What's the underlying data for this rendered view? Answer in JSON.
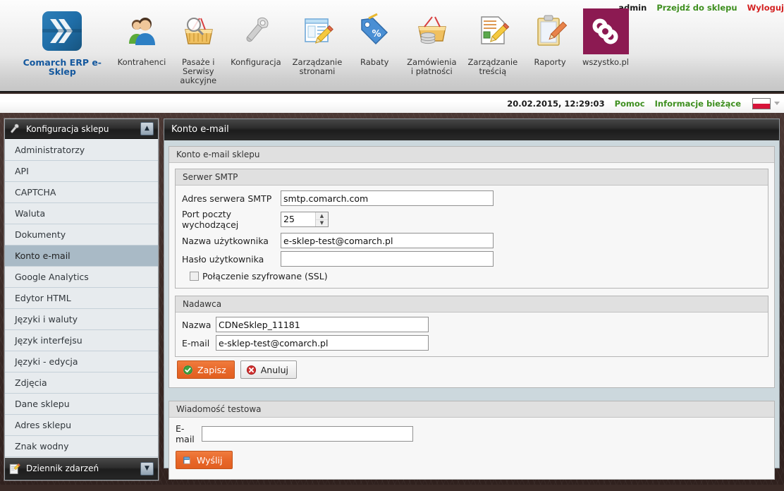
{
  "toolbar": {
    "items": [
      {
        "label": "Comarch ERP e-Sklep",
        "icon": "comarch-logo-icon"
      },
      {
        "label": "Kontrahenci",
        "icon": "users-icon"
      },
      {
        "label": "Pasaże i Serwisy aukcyjne",
        "icon": "basket-search-icon"
      },
      {
        "label": "Konfiguracja",
        "icon": "wrench-icon"
      },
      {
        "label": "Zarządzanie stronami",
        "icon": "page-edit-icon"
      },
      {
        "label": "Rabaty",
        "icon": "discount-tag-icon"
      },
      {
        "label": "Zamówienia i płatności",
        "icon": "basket-coins-icon"
      },
      {
        "label": "Zarządzanie treścią",
        "icon": "document-edit-icon"
      },
      {
        "label": "Raporty",
        "icon": "clipboard-icon"
      },
      {
        "label": "wszystko.pl",
        "icon": "infinity-icon"
      }
    ]
  },
  "userbar": {
    "user": "admin",
    "goto_shop": "Przejdź do sklepu",
    "logout": "Wyloguj"
  },
  "statusbar": {
    "datetime": "20.02.2015, 12:29:03",
    "help": "Pomoc",
    "current_info": "Informacje bieżące",
    "flag": "pl-flag-icon"
  },
  "sidebar": {
    "header": {
      "title": "Konfiguracja sklepu",
      "icon": "wrench-icon",
      "collapse": "▲"
    },
    "items": [
      {
        "label": "Administratorzy",
        "selected": false
      },
      {
        "label": "API",
        "selected": false
      },
      {
        "label": "CAPTCHA",
        "selected": false
      },
      {
        "label": "Waluta",
        "selected": false
      },
      {
        "label": "Dokumenty",
        "selected": false
      },
      {
        "label": "Konto e-mail",
        "selected": true
      },
      {
        "label": "Google Analytics",
        "selected": false
      },
      {
        "label": "Edytor HTML",
        "selected": false
      },
      {
        "label": "Języki i waluty",
        "selected": false
      },
      {
        "label": "Język interfejsu",
        "selected": false
      },
      {
        "label": "Języki - edycja",
        "selected": false
      },
      {
        "label": "Zdjęcia",
        "selected": false
      },
      {
        "label": "Dane sklepu",
        "selected": false
      },
      {
        "label": "Adres sklepu",
        "selected": false
      },
      {
        "label": "Znak wodny",
        "selected": false
      }
    ],
    "footer": {
      "title": "Dziennik zdarzeń",
      "icon": "notepad-icon",
      "expand": "▼"
    }
  },
  "content": {
    "title": "Konto e-mail",
    "panel_legend": "Konto e-mail sklepu",
    "smtp": {
      "legend": "Serwer SMTP",
      "server_label": "Adres serwera SMTP",
      "server_value": "smtp.comarch.com",
      "port_label": "Port poczty wychodzącej",
      "port_value": "25",
      "user_label": "Nazwa użytkownika",
      "user_value": "e-sklep-test@comarch.pl",
      "pass_label": "Hasło użytkownika",
      "pass_value": "",
      "ssl_label": "Połączenie szyfrowane (SSL)",
      "ssl_checked": false
    },
    "sender": {
      "legend": "Nadawca",
      "name_label": "Nazwa",
      "name_value": "CDNeSklep_11181",
      "email_label": "E-mail",
      "email_value": "e-sklep-test@comarch.pl"
    },
    "actions": {
      "save": "Zapisz",
      "cancel": "Anuluj",
      "save_icon": "check-circle-icon",
      "cancel_icon": "cancel-circle-icon"
    },
    "test_message": {
      "legend": "Wiadomość testowa",
      "email_label": "E-mail",
      "email_value": "",
      "send": "Wyślij",
      "send_icon": "send-flag-icon"
    }
  },
  "colors": {
    "accent_orange": "#e8682a",
    "link_green": "#3e8f1f",
    "link_red": "#d42222",
    "brand_blue": "#14589e",
    "selected_item": "#a9bac6"
  }
}
